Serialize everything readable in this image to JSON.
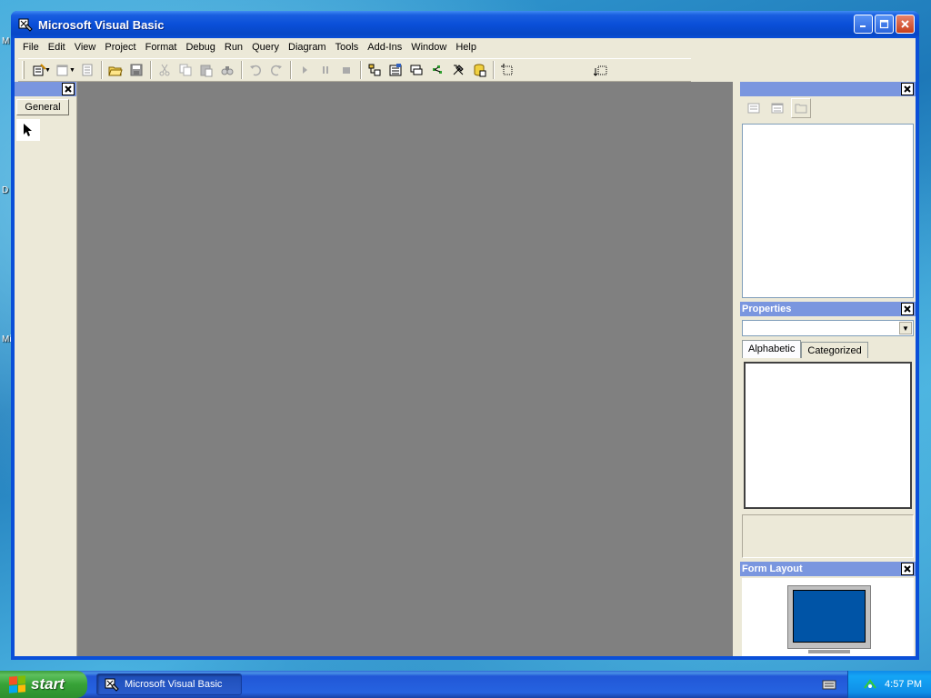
{
  "desktop": {
    "labels": [
      "M",
      "D",
      "Mi"
    ]
  },
  "window": {
    "title": "Microsoft Visual Basic",
    "buttons": {
      "minimize": "minimize",
      "maximize": "maximize",
      "close": "close"
    }
  },
  "menu": {
    "items": [
      "File",
      "Edit",
      "View",
      "Project",
      "Format",
      "Debug",
      "Run",
      "Query",
      "Diagram",
      "Tools",
      "Add-Ins",
      "Window",
      "Help"
    ]
  },
  "toolbar": {
    "icons": [
      "add-project-icon",
      "add-form-icon",
      "menu-editor-icon",
      "open-project-icon",
      "save-project-icon",
      "cut-icon",
      "copy-icon",
      "paste-icon",
      "find-icon",
      "undo-icon",
      "redo-icon",
      "start-icon",
      "break-icon",
      "end-icon",
      "project-explorer-icon",
      "properties-window-icon",
      "form-layout-icon",
      "object-browser-icon",
      "toolbox-icon",
      "data-view-icon",
      "component-manager-icon",
      "position-icon"
    ]
  },
  "toolbox": {
    "tab_label": "General"
  },
  "properties": {
    "title": "Properties",
    "tabs": [
      "Alphabetic",
      "Categorized"
    ],
    "object_value": ""
  },
  "form_layout": {
    "title": "Form Layout"
  },
  "taskbar": {
    "start_label": "start",
    "task_label": "Microsoft Visual Basic",
    "clock": "4:57 PM"
  },
  "colors": {
    "titlebar": "#0a4fd8",
    "mdi_background": "#808080",
    "panel_header": "#7a96df",
    "form_preview": "#0054a6"
  }
}
